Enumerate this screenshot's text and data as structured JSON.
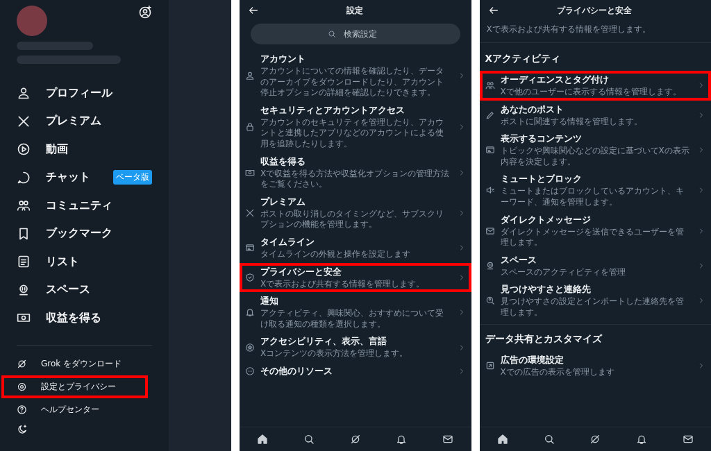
{
  "drawer": {
    "menu": [
      {
        "label": "プロフィール"
      },
      {
        "label": "プレミアム"
      },
      {
        "label": "動画"
      },
      {
        "label": "チャット",
        "badge": "ベータ版"
      },
      {
        "label": "コミュニティ"
      },
      {
        "label": "ブックマーク"
      },
      {
        "label": "リスト"
      },
      {
        "label": "スペース"
      },
      {
        "label": "収益を得る"
      }
    ],
    "footer": [
      {
        "label": "Grok をダウンロード",
        "highlighted": false
      },
      {
        "label": "設定とプライバシー",
        "highlighted": true
      },
      {
        "label": "ヘルプセンター",
        "highlighted": false
      }
    ]
  },
  "settings": {
    "title": "設定",
    "search": {
      "placeholder": "検索設定"
    },
    "items": [
      {
        "title": "アカウント",
        "subtitle": "アカウントについての情報を確認したり、データのアーカイブをダウンロードしたり、アカウント停止オプションの詳細を確認したりできます。",
        "highlighted": false
      },
      {
        "title": "セキュリティとアカウントアクセス",
        "subtitle": "アカウントのセキュリティを管理したり、アカウントと連携したアプリなどのアカウントによる使用を追跡したりします。",
        "highlighted": false
      },
      {
        "title": "収益を得る",
        "subtitle": "Xで収益を得る方法や収益化オプションの管理方法をご覧ください。",
        "highlighted": false
      },
      {
        "title": "プレミアム",
        "subtitle": "ポストの取り消しのタイミングなど、サブスクリプションの機能を管理します。",
        "highlighted": false
      },
      {
        "title": "タイムライン",
        "subtitle": "タイムラインの外観と操作を設定します",
        "highlighted": false
      },
      {
        "title": "プライバシーと安全",
        "subtitle": "Xで表示および共有する情報を管理します。",
        "highlighted": true
      },
      {
        "title": "通知",
        "subtitle": "アクティビティ、興味関心、おすすめについて受け取る通知の種類を選択します。",
        "highlighted": false
      },
      {
        "title": "アクセシビリティ、表示、言語",
        "subtitle": "Xコンテンツの表示方法を管理します。",
        "highlighted": false
      },
      {
        "title": "その他のリソース",
        "highlighted": false
      }
    ]
  },
  "privacy": {
    "title": "プライバシーと安全",
    "intro": "Xで表示および共有する情報を管理します。",
    "sections": [
      {
        "heading": "Xアクティビティ",
        "items": [
          {
            "title": "オーディエンスとタグ付け",
            "subtitle": "Xで他のユーザーに表示する情報を管理します。",
            "highlighted": true
          },
          {
            "title": "あなたのポスト",
            "subtitle": "ポストに関連する情報を管理します。",
            "highlighted": false
          },
          {
            "title": "表示するコンテンツ",
            "subtitle": "トピックや興味関心などの設定に基づいてXの表示内容を決定します。",
            "highlighted": false
          },
          {
            "title": "ミュートとブロック",
            "subtitle": "ミュートまたはブロックしているアカウント、キーワード、通知を管理します。",
            "highlighted": false
          },
          {
            "title": "ダイレクトメッセージ",
            "subtitle": "ダイレクトメッセージを送信できるユーザーを管理します。",
            "highlighted": false
          },
          {
            "title": "スペース",
            "subtitle": "スペースのアクティビティを管理",
            "highlighted": false
          },
          {
            "title": "見つけやすさと連絡先",
            "subtitle": "見つけやすさの設定とインポートした連絡先を管理します。",
            "highlighted": false
          }
        ]
      },
      {
        "heading": "データ共有とカスタマイズ",
        "items": [
          {
            "title": "広告の環境設定",
            "subtitle": "Xでの広告の表示を管理します",
            "highlighted": false
          }
        ]
      }
    ]
  }
}
